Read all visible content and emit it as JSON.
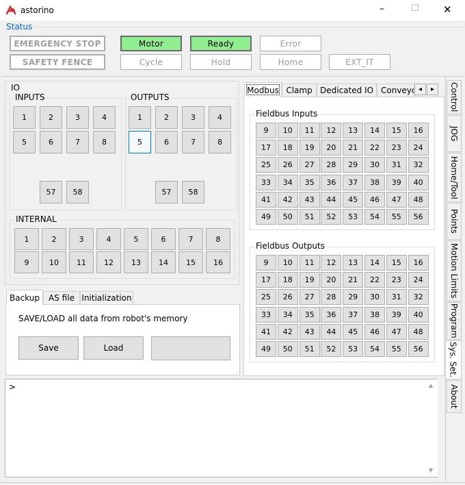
{
  "window": {
    "title": "astorino",
    "controls": {
      "minimize": "–",
      "maximize": "☐",
      "close": "✕"
    }
  },
  "status": {
    "label": "Status",
    "buttons": {
      "emergency_stop": "EMERGENCY STOP",
      "motor": "Motor",
      "ready": "Ready",
      "error": "Error",
      "safety_fence": "SAFETY FENCE",
      "cycle": "Cycle",
      "hold": "Hold",
      "home": "Home",
      "ext_it": "EXT_IT"
    }
  },
  "io": {
    "label": "IO",
    "inputs_label": "INPUTS",
    "outputs_label": "OUTPUTS",
    "internal_label": "INTERNAL",
    "inputs": [
      "1",
      "2",
      "3",
      "4",
      "5",
      "6",
      "7",
      "8",
      "57",
      "58"
    ],
    "outputs": [
      "1",
      "2",
      "3",
      "4",
      "5",
      "6",
      "7",
      "8",
      "57",
      "58"
    ],
    "internal": [
      "1",
      "2",
      "3",
      "4",
      "5",
      "6",
      "7",
      "8",
      "9",
      "10",
      "11",
      "12",
      "13",
      "14",
      "15",
      "16"
    ]
  },
  "backup_tabs": {
    "tabs": [
      "Backup",
      "AS file",
      "Initialization"
    ],
    "description": "SAVE/LOAD all data from robot's memory",
    "save": "Save",
    "load": "Load"
  },
  "right_tabs": {
    "tabs": [
      "Modbus",
      "Clamp",
      "Dedicated IO",
      "Conveyo"
    ],
    "scroll_left": "◂",
    "scroll_right": "▸"
  },
  "fieldbus": {
    "inputs_label": "Fieldbus Inputs",
    "outputs_label": "Fieldbus Outputs",
    "inputs": [
      "9",
      "10",
      "11",
      "12",
      "13",
      "14",
      "15",
      "16",
      "17",
      "18",
      "19",
      "20",
      "21",
      "22",
      "23",
      "24",
      "25",
      "26",
      "27",
      "28",
      "29",
      "30",
      "31",
      "32",
      "33",
      "34",
      "35",
      "36",
      "37",
      "38",
      "39",
      "40",
      "41",
      "42",
      "43",
      "44",
      "45",
      "46",
      "47",
      "48",
      "49",
      "50",
      "51",
      "52",
      "53",
      "54",
      "55",
      "56"
    ],
    "outputs": [
      "9",
      "10",
      "11",
      "12",
      "13",
      "14",
      "15",
      "16",
      "17",
      "18",
      "19",
      "20",
      "21",
      "22",
      "23",
      "24",
      "25",
      "26",
      "27",
      "28",
      "29",
      "30",
      "31",
      "32",
      "33",
      "34",
      "35",
      "36",
      "37",
      "38",
      "39",
      "40",
      "41",
      "42",
      "43",
      "44",
      "45",
      "46",
      "47",
      "48",
      "49",
      "50",
      "51",
      "52",
      "53",
      "54",
      "55",
      "56"
    ]
  },
  "console": {
    "prompt": ">"
  },
  "side_tabs": [
    "Control",
    "JOG",
    "Home/Tool",
    "Points",
    "Motion Limits",
    "Program",
    "Sys. Set.",
    "About"
  ],
  "colors": {
    "accent": "#d9232e",
    "green": "#90ee90",
    "status_label": "#0066cc"
  }
}
